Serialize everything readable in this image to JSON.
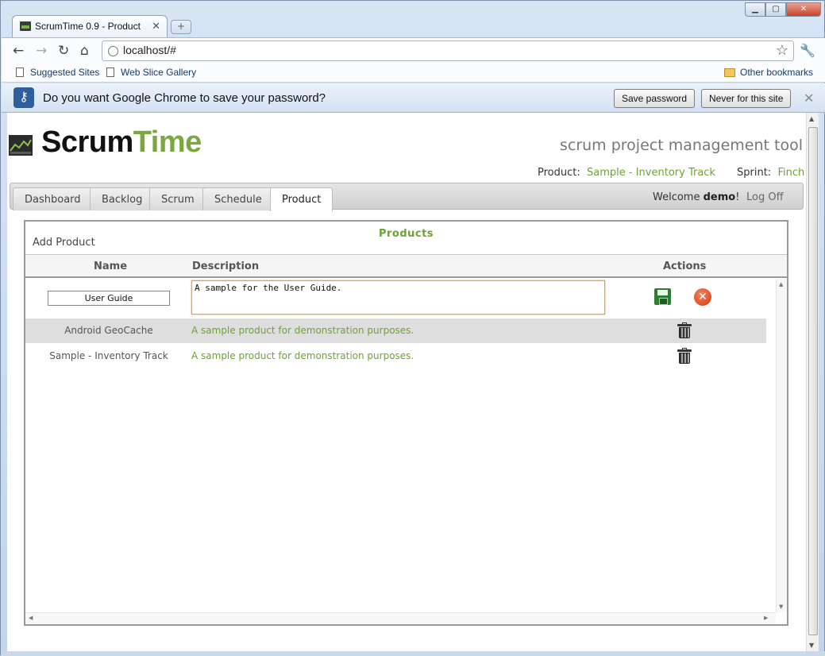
{
  "browser": {
    "tab_title": "ScrumTime 0.9 - Product",
    "url": "localhost/#",
    "bookmarks": [
      "Suggested Sites",
      "Web Slice Gallery"
    ],
    "other_bookmarks": "Other bookmarks",
    "infobar": {
      "message": "Do you want Google Chrome to save your password?",
      "save_label": "Save password",
      "never_label": "Never for this site"
    }
  },
  "app": {
    "logo_scrum": "Scrum",
    "logo_time": "Time",
    "tagline": "scrum project management tool",
    "product_label": "Product:",
    "product_value": "Sample - Inventory Track",
    "sprint_label": "Sprint:",
    "sprint_value": "Finch",
    "tabs": [
      {
        "label": "Dashboard"
      },
      {
        "label": "Backlog"
      },
      {
        "label": "Scrum"
      },
      {
        "label": "Schedule"
      },
      {
        "label": "Product",
        "active": true
      }
    ],
    "welcome_prefix": "Welcome ",
    "welcome_user": "demo",
    "welcome_suffix": "!",
    "log_off": "Log Off"
  },
  "products": {
    "title": "Products",
    "add_label": "Add Product",
    "columns": {
      "name": "Name",
      "description": "Description",
      "actions": "Actions"
    },
    "edit_row": {
      "name": "User Guide",
      "description": "A sample for the User Guide."
    },
    "rows": [
      {
        "name": "Android GeoCache",
        "description": "A sample product for demonstration purposes."
      },
      {
        "name": "Sample - Inventory Track",
        "description": "A sample product for demonstration purposes."
      }
    ]
  },
  "colors": {
    "accent_green": "#6ea235",
    "focus_orange": "#e8a13c"
  }
}
